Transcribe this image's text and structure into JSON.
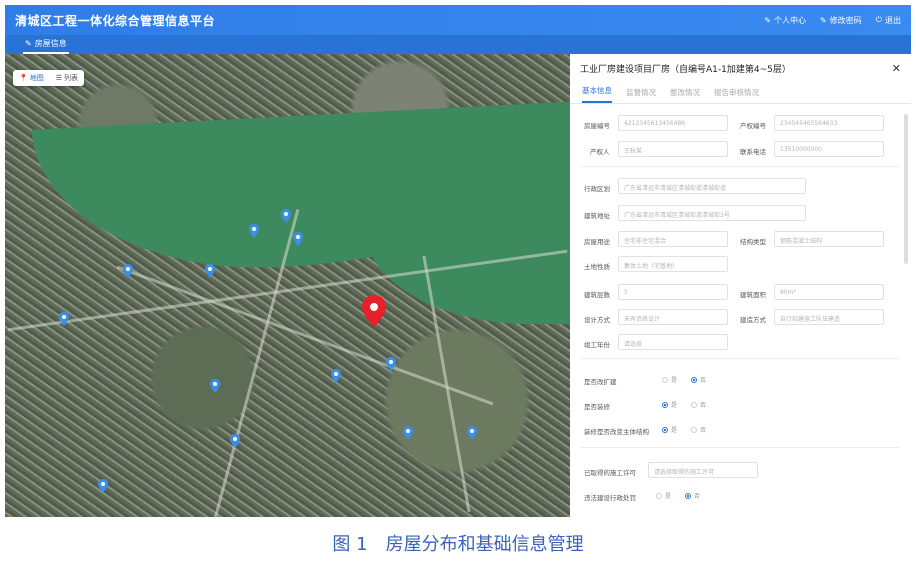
{
  "header": {
    "title": "清城区工程一体化综合管理信息平台",
    "actions": [
      "个人中心",
      "修改密码",
      "退出"
    ]
  },
  "subbar": {
    "tab": "房屋信息"
  },
  "map": {
    "controls": [
      "地图",
      "列表"
    ]
  },
  "panel": {
    "title": "工业厂房建设项目厂房（自编号A1-1加建第4~5层）",
    "tabs": [
      "基本信息",
      "监督情况",
      "整改情况",
      "报告审核情况"
    ],
    "fields": {
      "house_no": {
        "label": "房屋编号",
        "value": "4212345613456486"
      },
      "property_no": {
        "label": "产权编号",
        "value": "234545465564633"
      },
      "owner": {
        "label": "产权人",
        "value": "王秋某"
      },
      "phone": {
        "label": "联系电话",
        "value": "13510000000"
      },
      "district": {
        "label": "行政区划",
        "value": "广东省清远市清城区清城街道清城街道"
      },
      "address": {
        "label": "建筑地址",
        "value": "广东省清远市清城区清城街道清城街3号"
      },
      "usage": {
        "label": "房屋用途",
        "value": "住宅非住宅混合"
      },
      "structure": {
        "label": "结构类型",
        "value": "钢筋混凝土结构"
      },
      "land": {
        "label": "土地性质",
        "value": "集体土地（宅基地）"
      },
      "floors": {
        "label": "建筑层数",
        "value": "5"
      },
      "area": {
        "label": "建筑面积",
        "value": "80m²"
      },
      "design": {
        "label": "设计方式",
        "value": "未有资质设计"
      },
      "build": {
        "label": "建造方式",
        "value": "自行招建施工队伍建造"
      },
      "year": {
        "label": "竣工年份",
        "value": "请选择"
      }
    },
    "radios": [
      {
        "label": "是否改扩建",
        "options": [
          "是",
          "否"
        ],
        "selected": 1
      },
      {
        "label": "是否装修",
        "options": [
          "是",
          "否"
        ],
        "selected": 0
      },
      {
        "label": "装修是否改变主体结构",
        "options": [
          "是",
          "否"
        ],
        "selected": 0
      }
    ],
    "permit": {
      "label": "已取得的施工许可",
      "value": "请选择取得的施工许可"
    },
    "last_radio": {
      "label": "违法建设行政处罚",
      "options": [
        "是",
        "否"
      ],
      "selected": 1
    }
  },
  "caption": "图 1　房屋分布和基础信息管理",
  "colors": {
    "primary": "#2f7de6",
    "pin_blue": "#3b8fe8",
    "pin_red": "#e8202a"
  }
}
